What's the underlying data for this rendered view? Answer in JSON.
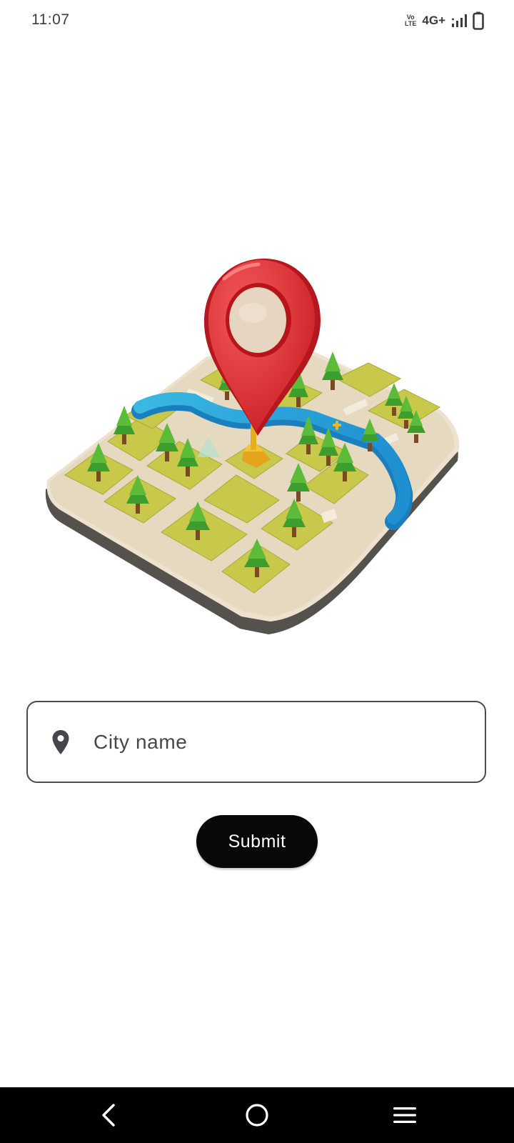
{
  "status_bar": {
    "time": "11:07",
    "volte_top": "Vo",
    "volte_bottom": "LTE",
    "network_type": "4G+",
    "icons": [
      "volte-icon",
      "signal-icon",
      "battery-icon"
    ]
  },
  "hero": {
    "icon": "map-location-illustration"
  },
  "city_input": {
    "icon": "location-pin-icon",
    "placeholder": "City name",
    "value": ""
  },
  "submit_button": {
    "label": "Submit"
  },
  "nav_bar": {
    "items": [
      "back-icon",
      "home-icon",
      "recents-menu-icon"
    ]
  },
  "colors": {
    "background": "#ffffff",
    "button": "#08070a",
    "button_text": "#ffffff",
    "field_border": "#4a4a4f",
    "nav_bar": "#000000"
  }
}
